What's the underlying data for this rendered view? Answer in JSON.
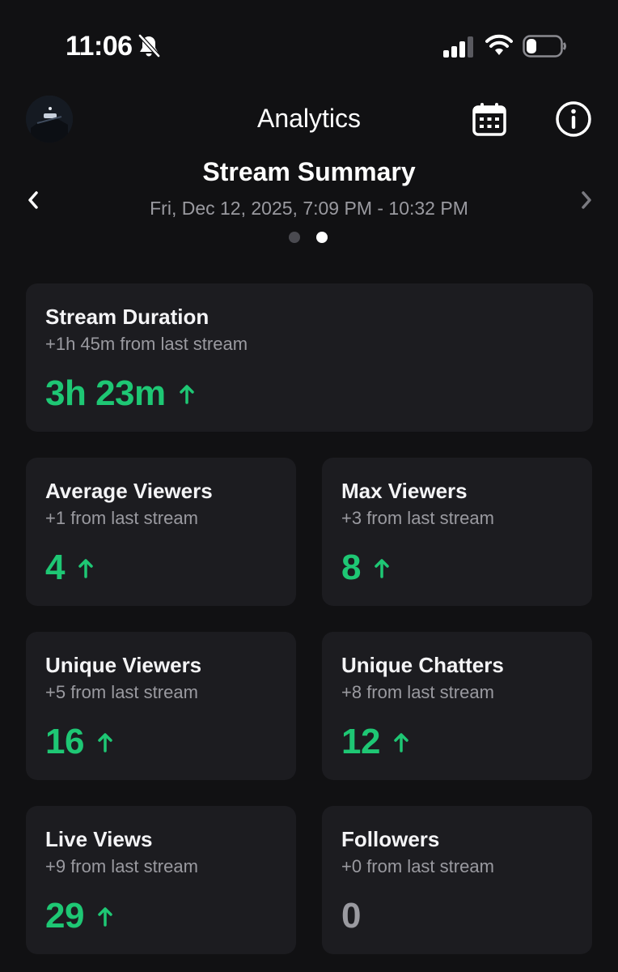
{
  "status_bar": {
    "time": "11:06",
    "icons": [
      "bell-slash-icon",
      "signal-icon",
      "wifi-icon",
      "battery-icon"
    ]
  },
  "header": {
    "title": "Analytics",
    "icons": [
      "avatar",
      "calendar-icon",
      "info-icon"
    ]
  },
  "summary": {
    "title": "Stream Summary",
    "date_range": "Fri, Dec 12, 2025, 7:09 PM - 10:32 PM",
    "page_count": 2,
    "active_page": 2
  },
  "colors": {
    "accent_green": "#1ec774",
    "card_bg": "#1c1c20",
    "muted_text": "#9a9aa0",
    "background": "#111113"
  },
  "cards": [
    {
      "title": "Stream Duration",
      "subtitle": "+1h 45m from last stream",
      "value": "3h 23m",
      "trend": "up"
    },
    {
      "title": "Average Viewers",
      "subtitle": "+1 from last stream",
      "value": "4",
      "trend": "up"
    },
    {
      "title": "Max Viewers",
      "subtitle": "+3 from last stream",
      "value": "8",
      "trend": "up"
    },
    {
      "title": "Unique Viewers",
      "subtitle": "+5 from last stream",
      "value": "16",
      "trend": "up"
    },
    {
      "title": "Unique Chatters",
      "subtitle": "+8 from last stream",
      "value": "12",
      "trend": "up"
    },
    {
      "title": "Live Views",
      "subtitle": "+9 from last stream",
      "value": "29",
      "trend": "up"
    },
    {
      "title": "Followers",
      "subtitle": "+0 from last stream",
      "value": "0",
      "trend": "none"
    }
  ]
}
